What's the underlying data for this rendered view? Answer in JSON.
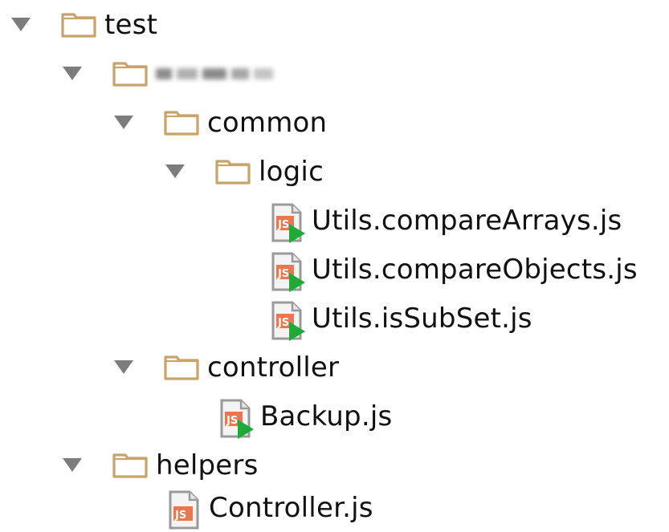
{
  "tree": {
    "root": {
      "label": "test"
    },
    "redacted_folder": {
      "label": ""
    },
    "common": {
      "label": "common"
    },
    "logic": {
      "label": "logic"
    },
    "files_logic": [
      {
        "label": "Utils.compareArrays.js"
      },
      {
        "label": "Utils.compareObjects.js"
      },
      {
        "label": "Utils.isSubSet.js"
      }
    ],
    "controller": {
      "label": "controller"
    },
    "backup": {
      "label": "Backup.js"
    },
    "helpers": {
      "label": "helpers"
    },
    "controller_js": {
      "label": "Controller.js"
    }
  },
  "colors": {
    "folder": "#c8a36a",
    "arrow": "#7d7d7d",
    "js_badge": "#e8764f",
    "run_marker": "#1faa38",
    "file_page": "#9a9a9a"
  },
  "icons": {
    "expanded": "triangle-down-icon",
    "folder": "folder-icon",
    "js_test_file": "js-test-file-icon",
    "js_file": "js-file-icon"
  }
}
